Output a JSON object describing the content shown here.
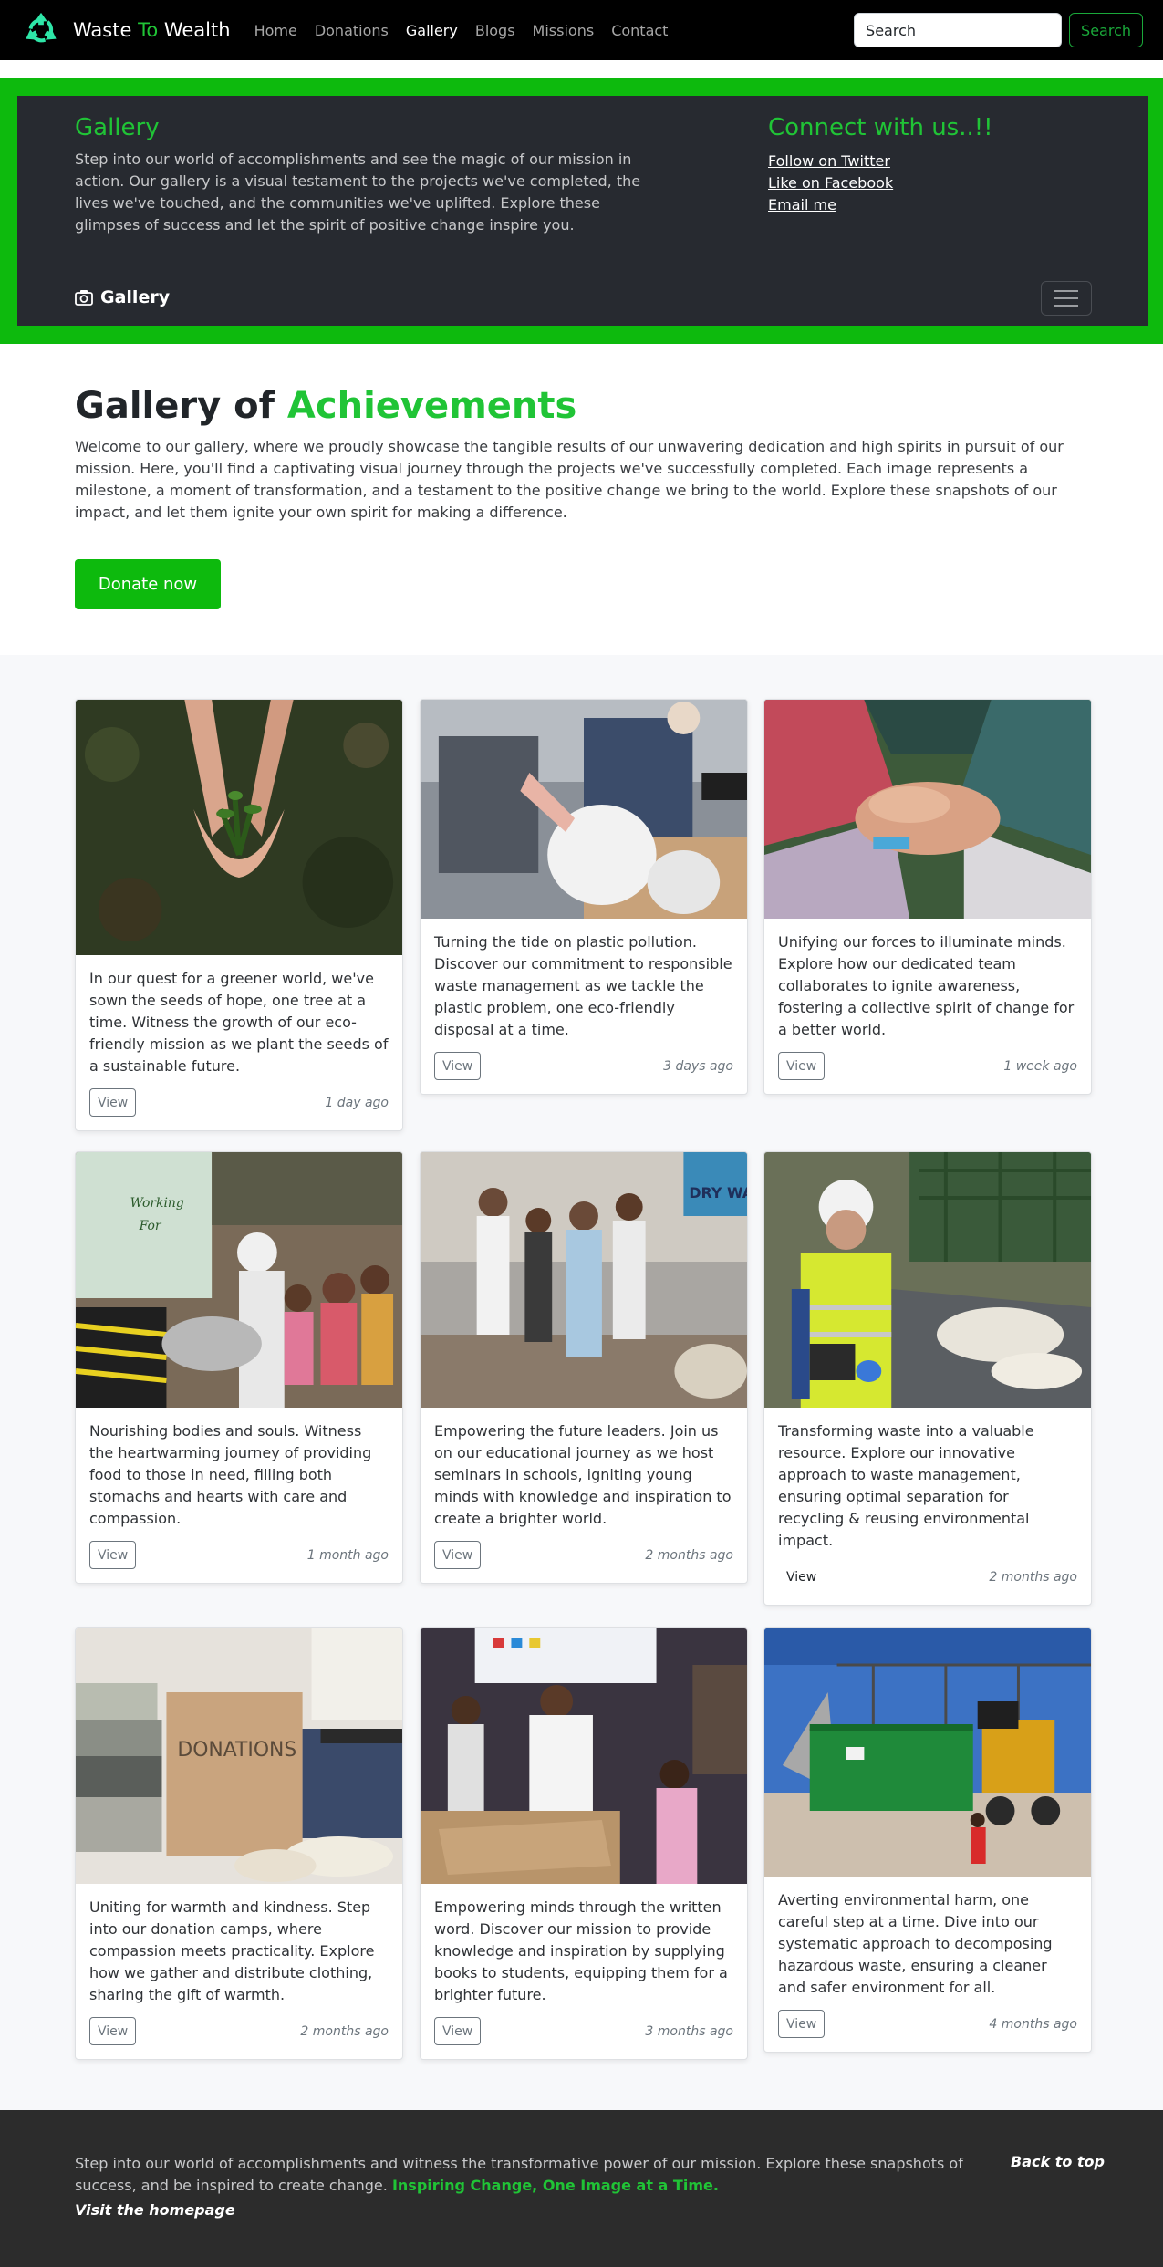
{
  "navbar": {
    "brand_prefix": "Waste ",
    "brand_accent": "To",
    "brand_suffix": " Wealth",
    "links": [
      "Home",
      "Donations",
      "Gallery",
      "Blogs",
      "Missions",
      "Contact"
    ],
    "active_link": "Gallery",
    "search_placeholder": "Search",
    "search_button": "Search"
  },
  "header": {
    "title": "Gallery",
    "description": "Step into our world of accomplishments and see the magic of our mission in action. Our gallery is a visual testament to the projects we've completed, the lives we've touched, and the communities we've uplifted. Explore these glimpses of success and let the spirit of positive change inspire you.",
    "connect_title": "Connect with us..!!",
    "connect_links": [
      "Follow on Twitter",
      "Like on Facebook",
      "Email me"
    ],
    "section_label": "Gallery"
  },
  "intro": {
    "title_prefix": "Gallery of ",
    "title_accent": "Achievements",
    "text": "Welcome to our gallery, where we proudly showcase the tangible results of our unwavering dedication and high spirits in pursuit of our mission. Here, you'll find a captivating visual journey through the projects we've successfully completed. Each image represents a milestone, a moment of transformation, and a testament to the positive change we bring to the world. Explore these snapshots of our impact, and let them ignite your own spirit for making a difference.",
    "donate_button": "Donate now"
  },
  "cards": [
    {
      "image": "hands-holding-seedling-photo",
      "text": "In our quest for a greener world, we've sown the seeds of hope, one tree at a time. Witness the growth of our eco-friendly mission as we plant the seeds of a sustainable future.",
      "button": "View",
      "time": "1 day ago"
    },
    {
      "image": "volunteers-plastic-bags-photo",
      "text": "Turning the tide on plastic pollution. Discover our commitment to responsible waste management as we tackle the plastic problem, one eco-friendly disposal at a time.",
      "button": "View",
      "time": "3 days ago"
    },
    {
      "image": "stacked-hands-team-photo",
      "text": "Unifying our forces to illuminate minds. Explore how our dedicated team collaborates to ignite awareness, fostering a collective spirit of change for a better world.",
      "button": "View",
      "time": "1 week ago"
    },
    {
      "image": "food-distribution-photo",
      "text": "Nourishing bodies and souls. Witness the heartwarming journey of providing food to those in need, filling both stomachs and hearts with care and compassion.",
      "button": "View",
      "time": "1 month ago"
    },
    {
      "image": "school-seminar-photo",
      "text": "Empowering the future leaders. Join us on our educational journey as we host seminars in schools, igniting young minds with knowledge and inspiration to create a brighter world.",
      "button": "View",
      "time": "2 months ago"
    },
    {
      "image": "recycling-worker-photo",
      "text": "Transforming waste into a valuable resource. Explore our innovative approach to waste management, ensuring optimal separation for recycling & reusing environmental impact.",
      "button": "View",
      "time": "2 months ago"
    },
    {
      "image": "clothes-donation-box-photo",
      "text": "Uniting for warmth and kindness. Step into our donation camps, where compassion meets practicality. Explore how we gather and distribute clothing, sharing the gift of warmth.",
      "button": "View",
      "time": "2 months ago"
    },
    {
      "image": "book-donation-photo",
      "text": "Empowering minds through the written word. Discover our mission to provide knowledge and inspiration by supplying books to students, equipping them for a brighter future.",
      "button": "View",
      "time": "3 months ago"
    },
    {
      "image": "waste-dumpster-site-photo",
      "text": "Averting environmental harm, one careful step at a time. Dive into our systematic approach to decomposing hazardous waste, ensuring a cleaner and safer environment for all.",
      "button": "View",
      "time": "4 months ago"
    }
  ],
  "footer": {
    "text": "Step into our world of accomplishments and witness the transformative power of our mission. Explore these snapshots of success, and be inspired to create change.",
    "tagline": "Inspiring Change, One Image at a Time.",
    "back_to_top": "Back to top",
    "home_link": "Visit the homepage"
  },
  "colors": {
    "accent_green": "#20c436",
    "frame_green": "#0dba0d",
    "navbar_bg": "#000000",
    "header_bg": "#272a30",
    "footer_bg": "#2c2c2c"
  }
}
